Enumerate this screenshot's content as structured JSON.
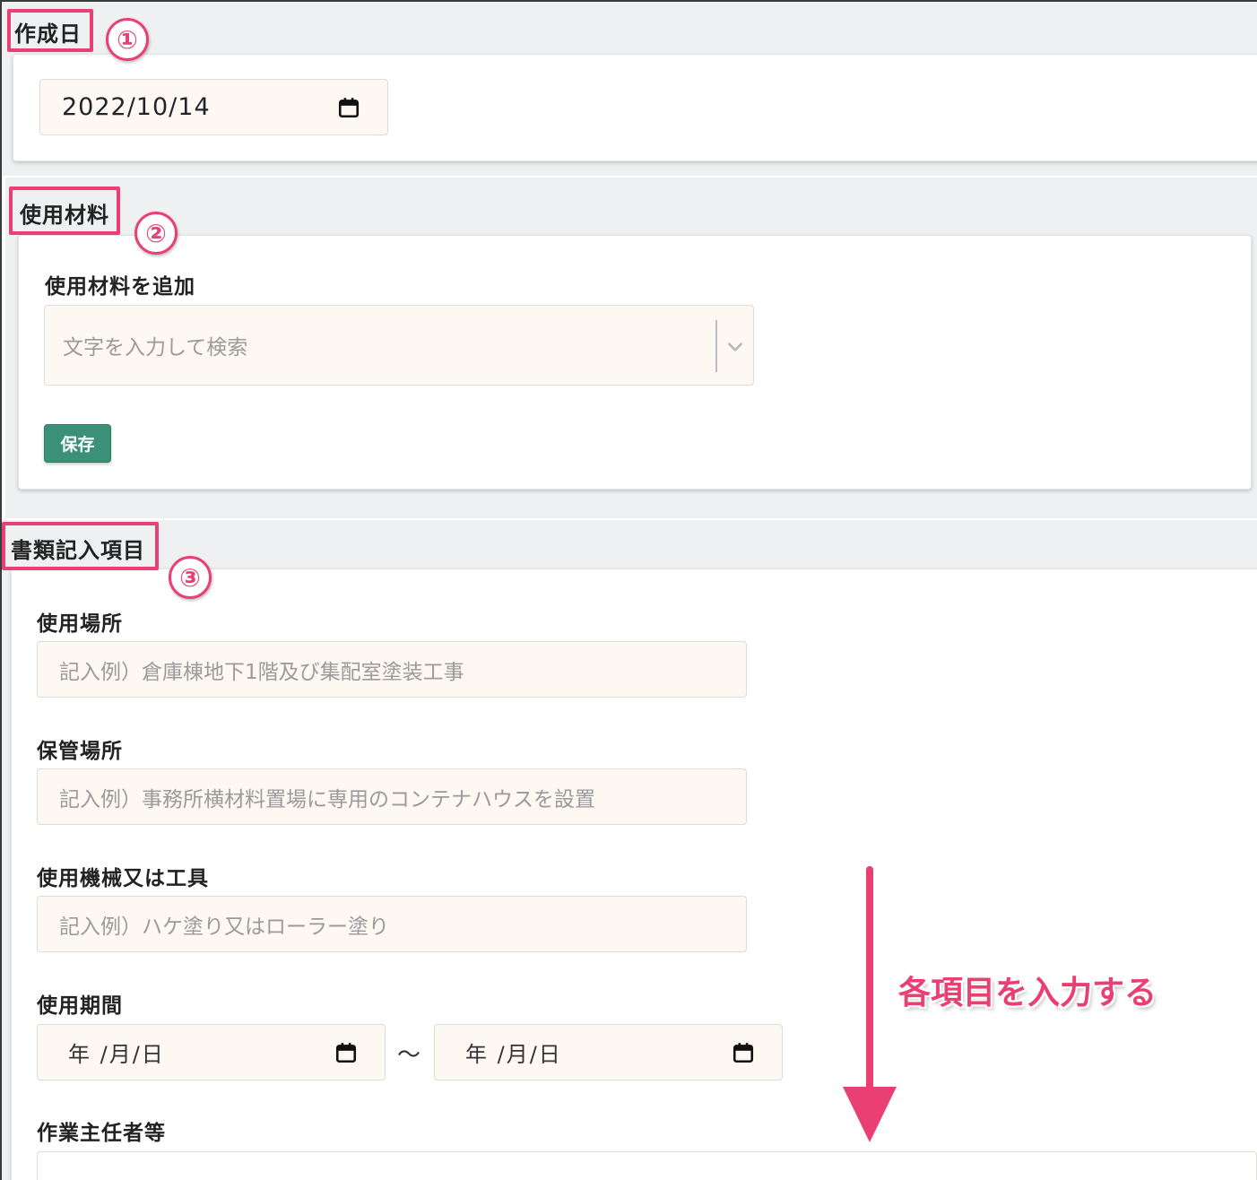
{
  "colors": {
    "accent": "#ea3f73",
    "save_button": "#3a9178",
    "input_background": "#fdf8f2",
    "section_band": "#eef0f1"
  },
  "section1": {
    "title": "作成日",
    "badge": "①",
    "date_value": "2022/10/14",
    "date_icon": "calendar-icon"
  },
  "section2": {
    "title": "使用材料",
    "badge": "②",
    "add_label": "使用材料を追加",
    "search_placeholder": "文字を入力して検索",
    "dropdown_icon": "chevron-down-icon",
    "save_label": "保存"
  },
  "section3": {
    "title": "書類記入項目",
    "badge": "③",
    "fields": [
      {
        "label": "使用場所",
        "placeholder": "記入例）倉庫棟地下1階及び集配室塗装工事"
      },
      {
        "label": "保管場所",
        "placeholder": "記入例）事務所横材料置場に専用のコンテナハウスを設置"
      },
      {
        "label": "使用機械又は工具",
        "placeholder": "記入例）ハケ塗り又はローラー塗り"
      }
    ],
    "period": {
      "label": "使用期間",
      "start_placeholder": "年 /月/日",
      "separator": "〜",
      "end_placeholder": "年 /月/日"
    },
    "supervisor_label": "作業主任者等"
  },
  "annotation": {
    "text": "各項目を入力する",
    "arrow_direction": "down"
  }
}
